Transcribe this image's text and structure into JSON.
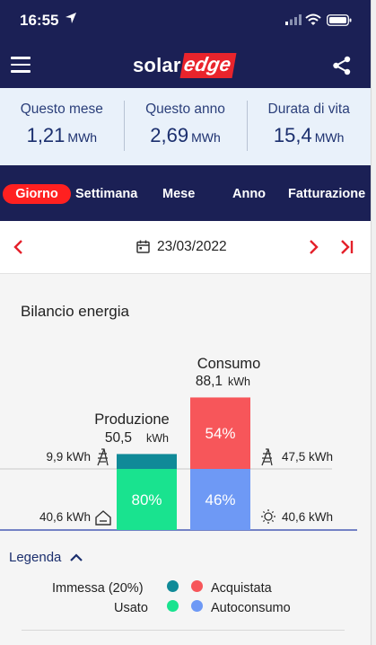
{
  "status_bar": {
    "time": "16:55"
  },
  "header": {
    "logo_part1": "solar",
    "logo_part2": "edge"
  },
  "summary": [
    {
      "label": "Questo mese",
      "value": "1,21",
      "unit": "MWh"
    },
    {
      "label": "Questo anno",
      "value": "2,69",
      "unit": "MWh"
    },
    {
      "label": "Durata di vita",
      "value": "15,4",
      "unit": "MWh"
    }
  ],
  "tabs": [
    {
      "label": "Giorno",
      "active": true
    },
    {
      "label": "Settimana",
      "active": false
    },
    {
      "label": "Mese",
      "active": false
    },
    {
      "label": "Anno",
      "active": false
    },
    {
      "label": "Fatturazione",
      "active": false
    }
  ],
  "date_nav": {
    "date": "23/03/2022"
  },
  "section": {
    "title": "Bilancio energia"
  },
  "colors": {
    "navy": "#1b2055",
    "active_tab": "#ff2020",
    "immessa": "#108a98",
    "usato": "#19e38f",
    "acquistata": "#f7565a",
    "autoconsumo": "#6e99f5"
  },
  "chart_data": {
    "type": "bar",
    "stacked": true,
    "categories": [
      "Produzione",
      "Consumo"
    ],
    "totals": [
      {
        "title": "Produzione",
        "value": "50,5",
        "unit": "kWh"
      },
      {
        "title": "Consumo",
        "value": "88,1",
        "unit": "kWh"
      }
    ],
    "series": [
      {
        "name": "Usato",
        "bar": "Produzione",
        "value": 40.6,
        "percent": "80%",
        "label": "40,6 kWh"
      },
      {
        "name": "Immessa (20%)",
        "bar": "Produzione",
        "value": 9.9,
        "percent": "",
        "label": "9,9 kWh"
      },
      {
        "name": "Autoconsumo",
        "bar": "Consumo",
        "value": 40.6,
        "percent": "46%",
        "label": "40,6 kWh"
      },
      {
        "name": "Acquistata",
        "bar": "Consumo",
        "value": 47.5,
        "percent": "54%",
        "label": "47,5 kWh"
      }
    ]
  },
  "legend": {
    "title": "Legenda",
    "items": [
      {
        "name": "Immessa (20%)",
        "color": "#108a98"
      },
      {
        "name": "Acquistata",
        "color": "#f7565a"
      },
      {
        "name": "Usato",
        "color": "#19e38f"
      },
      {
        "name": "Autoconsumo",
        "color": "#6e99f5"
      }
    ]
  }
}
